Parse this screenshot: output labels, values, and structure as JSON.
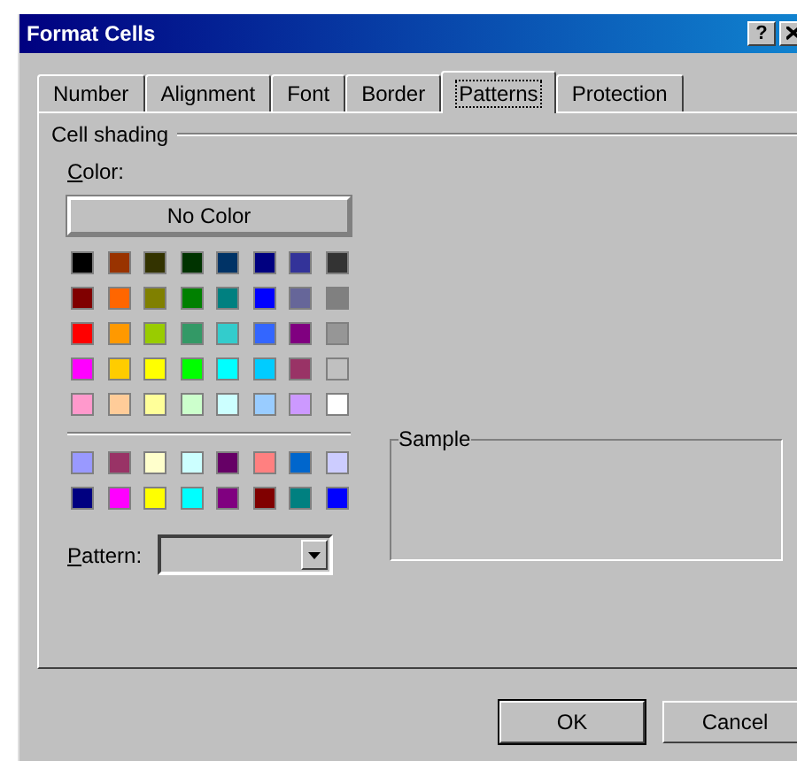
{
  "window": {
    "title": "Format Cells",
    "help_button": "?"
  },
  "tabs": [
    {
      "label": "Number",
      "selected": false
    },
    {
      "label": "Alignment",
      "selected": false
    },
    {
      "label": "Font",
      "selected": false
    },
    {
      "label": "Border",
      "selected": false
    },
    {
      "label": "Patterns",
      "selected": true
    },
    {
      "label": "Protection",
      "selected": false
    }
  ],
  "cell_shading": {
    "title": "Cell shading",
    "color_label": "Color:",
    "no_color_button": "No Color",
    "palette_rows": [
      [
        {
          "color": "#000000"
        },
        {
          "color": "#993300"
        },
        {
          "color": "#333300"
        },
        {
          "color": "#003300"
        },
        {
          "color": "#003366"
        },
        {
          "color": "#000080"
        },
        {
          "color": "#333399"
        },
        {
          "color": "#333333"
        }
      ],
      [
        {
          "color": "#800000"
        },
        {
          "color": "#ff6600"
        },
        {
          "color": "#808000"
        },
        {
          "color": "#008000"
        },
        {
          "color": "#008080"
        },
        {
          "color": "#0000ff"
        },
        {
          "color": "#666699"
        },
        {
          "color": "#808080"
        }
      ],
      [
        {
          "color": "#ff0000"
        },
        {
          "color": "#ff9900"
        },
        {
          "color": "#99cc00"
        },
        {
          "color": "#339966"
        },
        {
          "color": "#33cccc"
        },
        {
          "color": "#3366ff"
        },
        {
          "color": "#800080"
        },
        {
          "color": "#969696"
        }
      ],
      [
        {
          "color": "#ff00ff"
        },
        {
          "color": "#ffcc00"
        },
        {
          "color": "#ffff00"
        },
        {
          "color": "#00ff00"
        },
        {
          "color": "#00ffff"
        },
        {
          "color": "#00ccff"
        },
        {
          "color": "#993366"
        },
        {
          "color": "#c0c0c0"
        }
      ],
      [
        {
          "color": "#ff99cc"
        },
        {
          "color": "#ffcc99"
        },
        {
          "color": "#ffff99"
        },
        {
          "color": "#ccffcc"
        },
        {
          "color": "#ccffff"
        },
        {
          "color": "#99ccff"
        },
        {
          "color": "#cc99ff"
        },
        {
          "color": "#ffffff"
        }
      ]
    ],
    "chart_rows": [
      [
        {
          "color": "#9999ff"
        },
        {
          "color": "#993366"
        },
        {
          "color": "#ffffcc"
        },
        {
          "color": "#ccffff"
        },
        {
          "color": "#660066"
        },
        {
          "color": "#ff8080"
        },
        {
          "color": "#0066cc"
        },
        {
          "color": "#ccccff"
        }
      ],
      [
        {
          "color": "#000080"
        },
        {
          "color": "#ff00ff"
        },
        {
          "color": "#ffff00"
        },
        {
          "color": "#00ffff"
        },
        {
          "color": "#800080"
        },
        {
          "color": "#800000"
        },
        {
          "color": "#008080"
        },
        {
          "color": "#0000ff"
        }
      ]
    ],
    "pattern_label": "Pattern:"
  },
  "sample": {
    "title": "Sample"
  },
  "buttons": [
    "OK",
    "Cancel"
  ]
}
